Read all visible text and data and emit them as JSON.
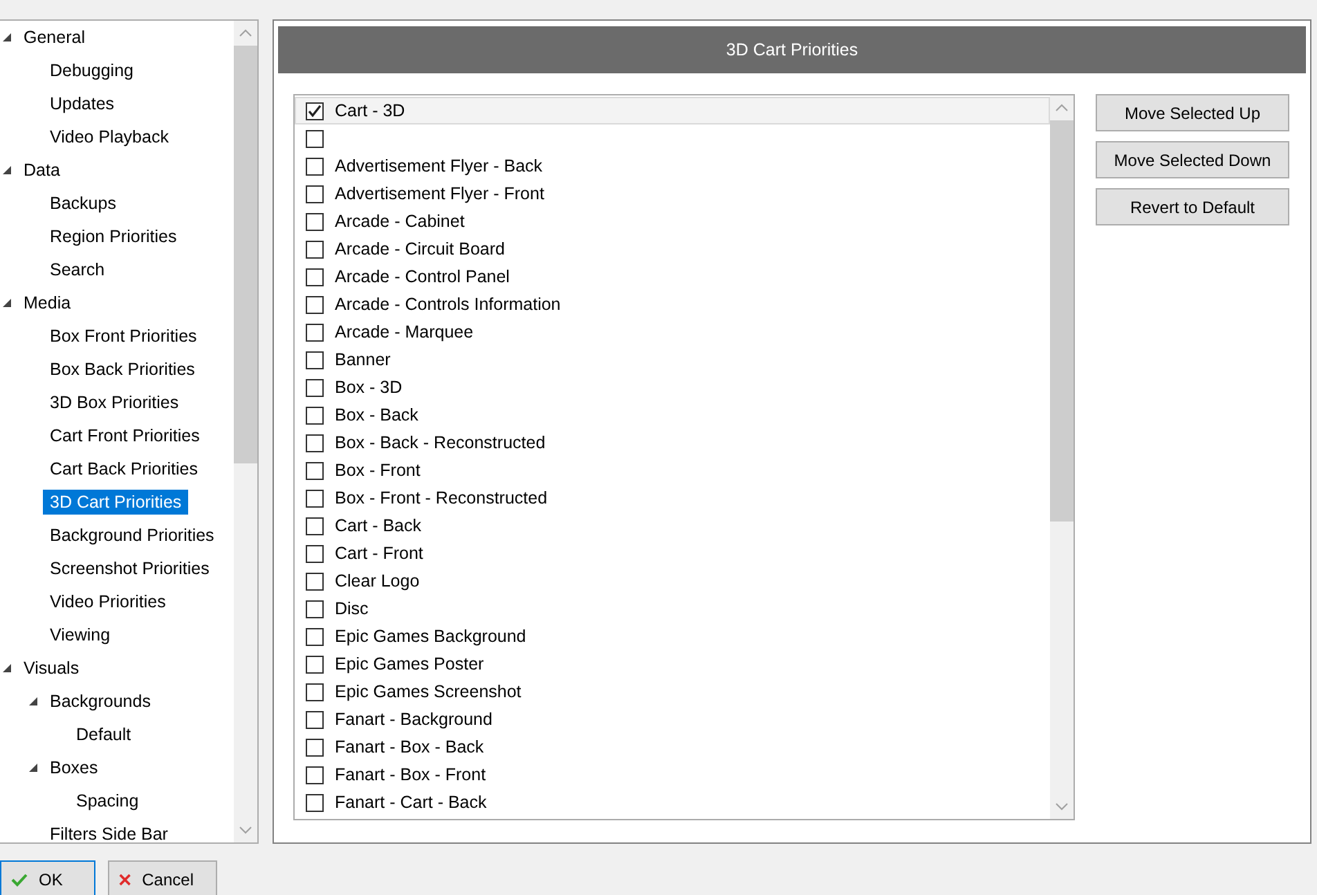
{
  "tree": [
    {
      "label": "General",
      "expanded": true,
      "selected": false,
      "children": [
        {
          "label": "Debugging",
          "selected": false
        },
        {
          "label": "Updates",
          "selected": false
        },
        {
          "label": "Video Playback",
          "selected": false
        }
      ]
    },
    {
      "label": "Data",
      "expanded": true,
      "selected": false,
      "children": [
        {
          "label": "Backups",
          "selected": false
        },
        {
          "label": "Region Priorities",
          "selected": false
        },
        {
          "label": "Search",
          "selected": false
        }
      ]
    },
    {
      "label": "Media",
      "expanded": true,
      "selected": false,
      "children": [
        {
          "label": "Box Front Priorities",
          "selected": false
        },
        {
          "label": "Box Back Priorities",
          "selected": false
        },
        {
          "label": "3D Box Priorities",
          "selected": false
        },
        {
          "label": "Cart Front Priorities",
          "selected": false
        },
        {
          "label": "Cart Back Priorities",
          "selected": false
        },
        {
          "label": "3D Cart Priorities",
          "selected": true
        },
        {
          "label": "Background Priorities",
          "selected": false
        },
        {
          "label": "Screenshot Priorities",
          "selected": false
        },
        {
          "label": "Video Priorities",
          "selected": false
        },
        {
          "label": "Viewing",
          "selected": false
        }
      ]
    },
    {
      "label": "Visuals",
      "expanded": true,
      "selected": false,
      "children": [
        {
          "label": "Backgrounds",
          "expanded": true,
          "selected": false,
          "children": [
            {
              "label": "Default",
              "selected": false
            }
          ]
        },
        {
          "label": "Boxes",
          "expanded": true,
          "selected": false,
          "children": [
            {
              "label": "Spacing",
              "selected": false
            }
          ]
        },
        {
          "label": "Filters Side Bar",
          "selected": false
        }
      ]
    }
  ],
  "panel": {
    "title": "3D Cart Priorities",
    "items": [
      {
        "label": "Cart - 3D",
        "checked": true,
        "selected": true
      },
      {
        "checked": false,
        "selected": false
      },
      {
        "label": "Advertisement Flyer - Back",
        "checked": false,
        "selected": false
      },
      {
        "label": "Advertisement Flyer - Front",
        "checked": false,
        "selected": false
      },
      {
        "label": "Arcade - Cabinet",
        "checked": false,
        "selected": false
      },
      {
        "label": "Arcade - Circuit Board",
        "checked": false,
        "selected": false
      },
      {
        "label": "Arcade - Control Panel",
        "checked": false,
        "selected": false
      },
      {
        "label": "Arcade - Controls Information",
        "checked": false,
        "selected": false
      },
      {
        "label": "Arcade - Marquee",
        "checked": false,
        "selected": false
      },
      {
        "label": "Banner",
        "checked": false,
        "selected": false
      },
      {
        "label": "Box - 3D",
        "checked": false,
        "selected": false
      },
      {
        "label": "Box - Back",
        "checked": false,
        "selected": false
      },
      {
        "label": "Box - Back - Reconstructed",
        "checked": false,
        "selected": false
      },
      {
        "label": "Box - Front",
        "checked": false,
        "selected": false
      },
      {
        "label": "Box - Front - Reconstructed",
        "checked": false,
        "selected": false
      },
      {
        "label": "Cart - Back",
        "checked": false,
        "selected": false
      },
      {
        "label": "Cart - Front",
        "checked": false,
        "selected": false
      },
      {
        "label": "Clear Logo",
        "checked": false,
        "selected": false
      },
      {
        "label": "Disc",
        "checked": false,
        "selected": false
      },
      {
        "label": "Epic Games Background",
        "checked": false,
        "selected": false
      },
      {
        "label": "Epic Games Poster",
        "checked": false,
        "selected": false
      },
      {
        "label": "Epic Games Screenshot",
        "checked": false,
        "selected": false
      },
      {
        "label": "Fanart - Background",
        "checked": false,
        "selected": false
      },
      {
        "label": "Fanart - Box - Back",
        "checked": false,
        "selected": false
      },
      {
        "label": "Fanart - Box - Front",
        "checked": false,
        "selected": false
      },
      {
        "label": "Fanart - Cart - Back",
        "checked": false,
        "selected": false
      }
    ],
    "buttons": [
      "Move Selected Up",
      "Move Selected Down",
      "Revert to Default"
    ]
  },
  "footer": {
    "ok": "OK",
    "cancel": "Cancel"
  }
}
